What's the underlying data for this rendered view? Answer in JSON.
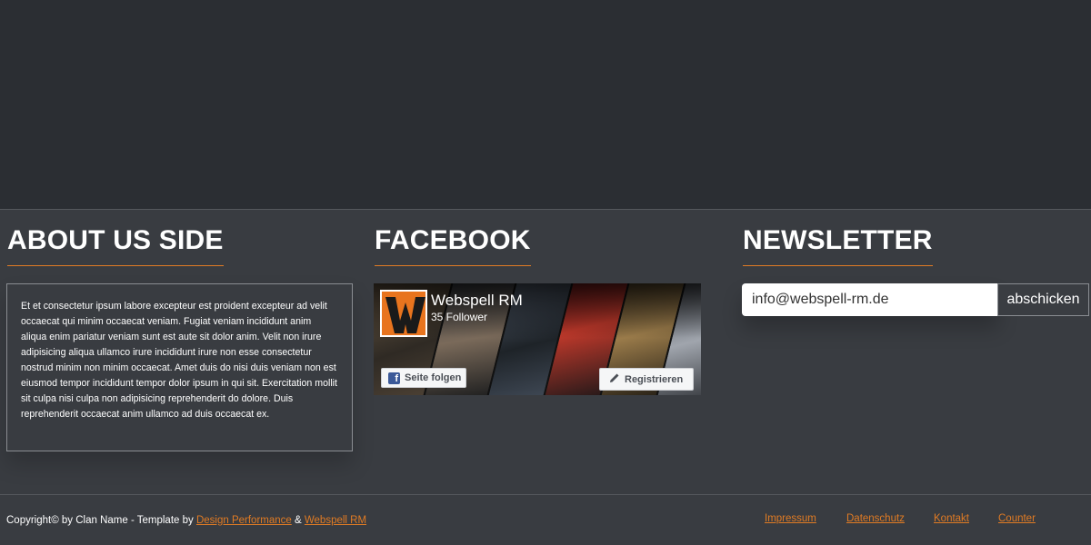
{
  "about": {
    "heading": "ABOUT US SIDE",
    "text": "Et et consectetur ipsum labore excepteur est proident excepteur ad velit occaecat qui minim occaecat veniam. Fugiat veniam incididunt anim aliqua enim pariatur veniam sunt est aute sit dolor anim. Velit non irure adipisicing aliqua ullamco irure incididunt irure non esse consectetur nostrud minim non minim occaecat. Amet duis do nisi duis veniam non est eiusmod tempor incididunt tempor dolor ipsum in qui sit. Exercitation mollit sit culpa nisi culpa non adipisicing reprehenderit do dolore. Duis reprehenderit occaecat anim ullamco ad duis occaecat ex."
  },
  "facebook": {
    "heading": "FACEBOOK",
    "page_name": "Webspell RM",
    "followers": "35 Follower",
    "follow_label": "Seite folgen",
    "register_label": "Registrieren"
  },
  "newsletter": {
    "heading": "NEWSLETTER",
    "email_value": "info@webspell-rm.de",
    "submit_label": "abschicken"
  },
  "footer": {
    "copyright_prefix": "Copyright© by Clan Name - Template by",
    "link1": "Design Performance",
    "separator": "&",
    "link2": "Webspell RM",
    "nav": [
      "Impressum",
      "Datenschutz",
      "Kontakt",
      "Counter"
    ]
  },
  "colors": {
    "accent": "#e07b24",
    "background": "#2b2e33",
    "panel": "#393c41"
  },
  "icons": [
    "facebook-f-icon",
    "pencil-icon"
  ]
}
